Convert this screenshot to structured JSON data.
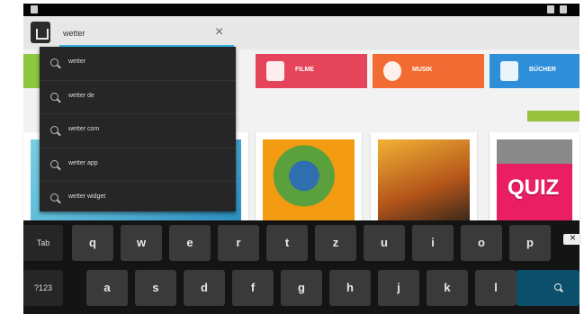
{
  "search": {
    "value": "wetter",
    "clear_label": "×"
  },
  "categories": [
    {
      "label": "FILME",
      "color": "#e5455a",
      "shade": "#c53449"
    },
    {
      "label": "MUSIK",
      "color": "#f26b32",
      "shade": "#d2552a"
    },
    {
      "label": "BÜCHER",
      "color": "#2e8fd8",
      "shade": "#206fb0"
    }
  ],
  "suggestions": [
    {
      "text": "wetter"
    },
    {
      "text": "wetter de"
    },
    {
      "text": "wetter com"
    },
    {
      "text": "wetter app"
    },
    {
      "text": "wetter widget"
    }
  ],
  "apps": {
    "quiz_label": "QUIZ"
  },
  "keyboard": {
    "row1": [
      "Tab",
      "q",
      "w",
      "e",
      "r",
      "t",
      "z",
      "u",
      "i",
      "o",
      "p"
    ],
    "row2": [
      "?123",
      "a",
      "s",
      "d",
      "f",
      "g",
      "h",
      "j",
      "k",
      "l"
    ]
  }
}
